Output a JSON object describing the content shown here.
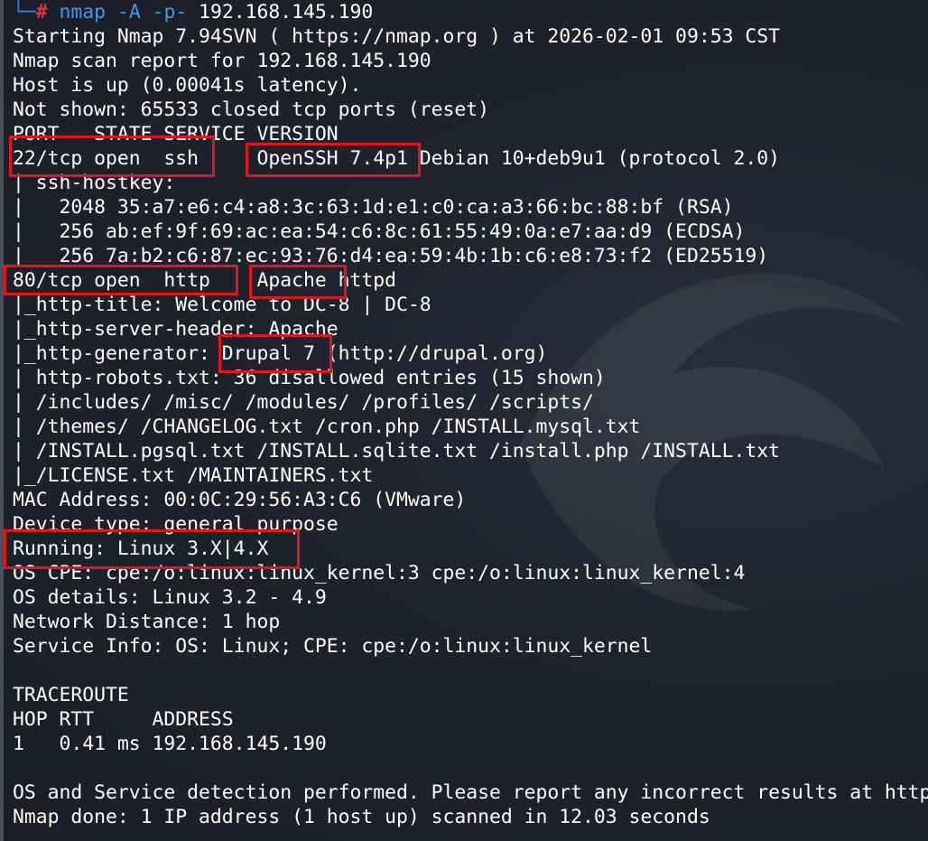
{
  "prompt": {
    "corner": "└─",
    "hash": "#",
    "command": "nmap -A -p-",
    "target": " 192.168.145.190"
  },
  "output_lines": [
    "Starting Nmap 7.94SVN ( https://nmap.org ) at 2026-02-01 09:53 CST",
    "Nmap scan report for 192.168.145.190",
    "Host is up (0.00041s latency).",
    "Not shown: 65533 closed tcp ports (reset)",
    "PORT   STATE SERVICE VERSION",
    "22/tcp open  ssh     OpenSSH 7.4p1 Debian 10+deb9u1 (protocol 2.0)",
    "| ssh-hostkey: ",
    "|   2048 35:a7:e6:c4:a8:3c:63:1d:e1:c0:ca:a3:66:bc:88:bf (RSA)",
    "|   256 ab:ef:9f:69:ac:ea:54:c6:8c:61:55:49:0a:e7:aa:d9 (ECDSA)",
    "|_  256 7a:b2:c6:87:ec:93:76:d4:ea:59:4b:1b:c6:e8:73:f2 (ED25519)",
    "80/tcp open  http    Apache httpd",
    "|_http-title: Welcome to DC-8 | DC-8",
    "|_http-server-header: Apache",
    "|_http-generator: Drupal 7 (http://drupal.org)",
    "| http-robots.txt: 36 disallowed entries (15 shown)",
    "| /includes/ /misc/ /modules/ /profiles/ /scripts/ ",
    "| /themes/ /CHANGELOG.txt /cron.php /INSTALL.mysql.txt ",
    "| /INSTALL.pgsql.txt /INSTALL.sqlite.txt /install.php /INSTALL.txt ",
    "|_/LICENSE.txt /MAINTAINERS.txt",
    "MAC Address: 00:0C:29:56:A3:C6 (VMware)",
    "Device type: general purpose",
    "Running: Linux 3.X|4.X",
    "OS CPE: cpe:/o:linux:linux_kernel:3 cpe:/o:linux:linux_kernel:4",
    "OS details: Linux 3.2 - 4.9",
    "Network Distance: 1 hop",
    "Service Info: OS: Linux; CPE: cpe:/o:linux:linux_kernel",
    "",
    "TRACEROUTE",
    "HOP RTT     ADDRESS",
    "1   0.41 ms 192.168.145.190",
    "",
    "OS and Service detection performed. Please report any incorrect results at https://nmap.org/submit/ .",
    "Nmap done: 1 IP address (1 host up) scanned in 12.03 seconds"
  ],
  "highlights": [
    {
      "label": "22/tcp open ssh"
    },
    {
      "label": "OpenSSH 7.4p1"
    },
    {
      "label": "80/tcp open http"
    },
    {
      "label": "Apache"
    },
    {
      "label": "Drupal 7"
    },
    {
      "label": "Running: Linux 3.X|4.X"
    }
  ],
  "colors": {
    "background": "#1d1f2b",
    "text": "#ffffff",
    "prompt_hash": "#e0333b",
    "prompt_command": "#3f9be6",
    "highlight_box": "#e0161f"
  }
}
